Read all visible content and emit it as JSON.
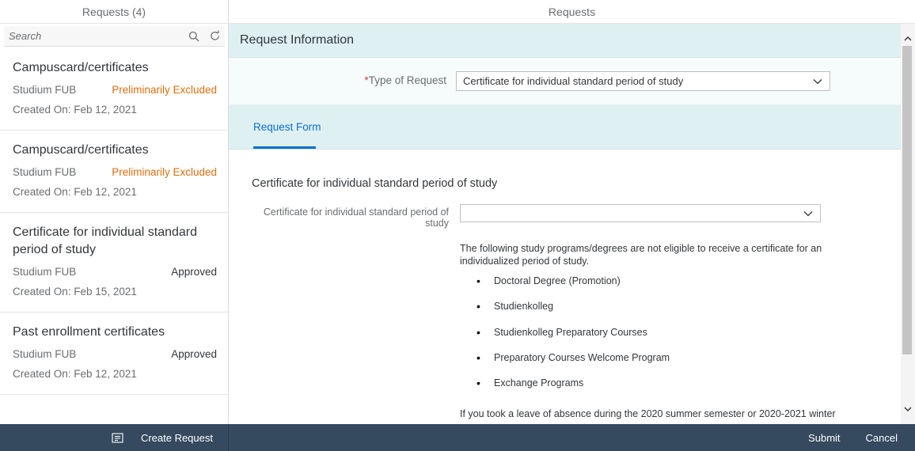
{
  "master": {
    "header": "Requests (4)",
    "search_placeholder": "Search",
    "search_icon": "search-icon",
    "refresh_icon": "refresh-icon",
    "items": [
      {
        "title": "Campuscard/certificates",
        "org": "Studium FUB",
        "status": "Preliminarily Excluded",
        "created": "Created On: Feb 12, 2021"
      },
      {
        "title": "Campuscard/certificates",
        "org": "Studium FUB",
        "status": "Preliminarily Excluded",
        "created": "Created On: Feb 12, 2021"
      },
      {
        "title": "Certificate for individual standard period of study",
        "org": "Studium FUB",
        "status": "Approved",
        "created": "Created On: Feb 15, 2021"
      },
      {
        "title": "Past enrollment certificates",
        "org": "Studium FUB",
        "status": "Approved",
        "created": "Created On: Feb 12, 2021"
      }
    ],
    "create_request_label": "Create Request"
  },
  "detail": {
    "header": "Requests",
    "section_title": "Request Information",
    "type_label_required": "*",
    "type_label": "Type of Request",
    "type_value": "Certificate for individual standard period of study",
    "tab_label": "Request Form",
    "form_heading": "Certificate for individual standard period of study",
    "form_label": "Certificate for individual standard period of study",
    "form_value": "",
    "info_text": "The following study programs/degrees are not eligible to receive a certificate for an individualized period of study.",
    "bullets": [
      "Doctoral Degree (Promotion)",
      "Studienkolleg",
      "Studienkolleg Preparatory Courses",
      "Preparatory Courses Welcome Program",
      "Exchange Programs"
    ],
    "info_text2": "If you took a leave of absence during the 2020 summer semester or 2020-2021 winter",
    "submit_label": "Submit",
    "cancel_label": "Cancel"
  },
  "colors": {
    "accent": "#0a6ed1",
    "excluded": "#df6e0c",
    "footer": "#354a5f",
    "section_bg": "#dff0f3"
  }
}
